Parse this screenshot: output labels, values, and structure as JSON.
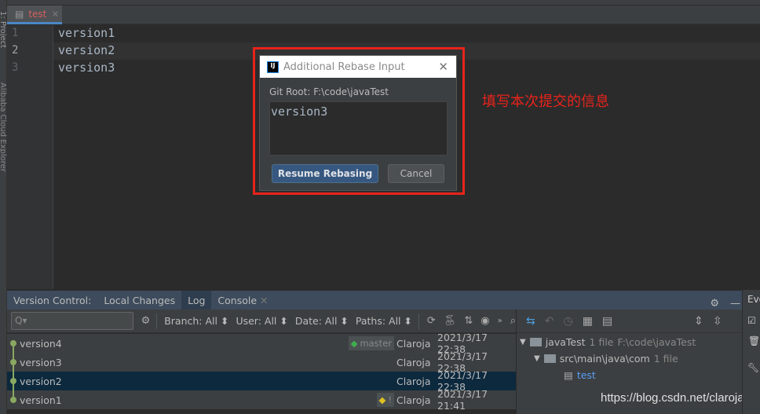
{
  "sidebar": {
    "project_label": "1: Project",
    "cloud_label": "Alibaba Cloud Explorer"
  },
  "editor": {
    "tab_name": "test",
    "lines": [
      {
        "num": "1",
        "text": "version1"
      },
      {
        "num": "2",
        "text": "version2"
      },
      {
        "num": "3",
        "text": "version3"
      }
    ]
  },
  "dialog": {
    "title": "Additional Rebase Input",
    "logo": "IJ",
    "git_root": "Git Root: F:\\code\\javaTest",
    "message": "version3",
    "resume_label": "Resume Rebasing",
    "cancel_label": "Cancel"
  },
  "annotation": "填写本次提交的信息",
  "vc": {
    "title": "Version Control:",
    "tabs": [
      "Local Changes",
      "Log",
      "Console"
    ],
    "active_tab": "Log"
  },
  "toolbar": {
    "search_placeholder": "Q▾",
    "branch": "Branch: All ⬍",
    "user": "User: All ⬍",
    "date": "Date: All ⬍",
    "paths": "Paths: All ⬍"
  },
  "log": [
    {
      "subject": "version4",
      "tag": "master",
      "author": "Claroja",
      "date": "2021/3/17 22:38"
    },
    {
      "subject": "version3",
      "author": "Claroja",
      "date": "2021/3/17 22:38"
    },
    {
      "subject": "version2",
      "author": "Claroja",
      "date": "2021/3/17 22:38",
      "selected": true
    },
    {
      "subject": "version1",
      "tag": "!",
      "author": "Claroja",
      "date": "2021/3/17 21:41"
    }
  ],
  "changes": {
    "root": "javaTest",
    "root_count": "1 file",
    "root_path": "F:\\code\\javaTest",
    "dir": "src\\main\\java\\com",
    "dir_count": "1 file",
    "file": "test"
  },
  "far_right_label": "Eve",
  "watermark": "https://blog.csdn.net/claroja",
  "colors": {
    "accent": "#4a88c7",
    "annotation": "#e8231b",
    "selection": "#0d293e",
    "graph": "#8aa861"
  }
}
